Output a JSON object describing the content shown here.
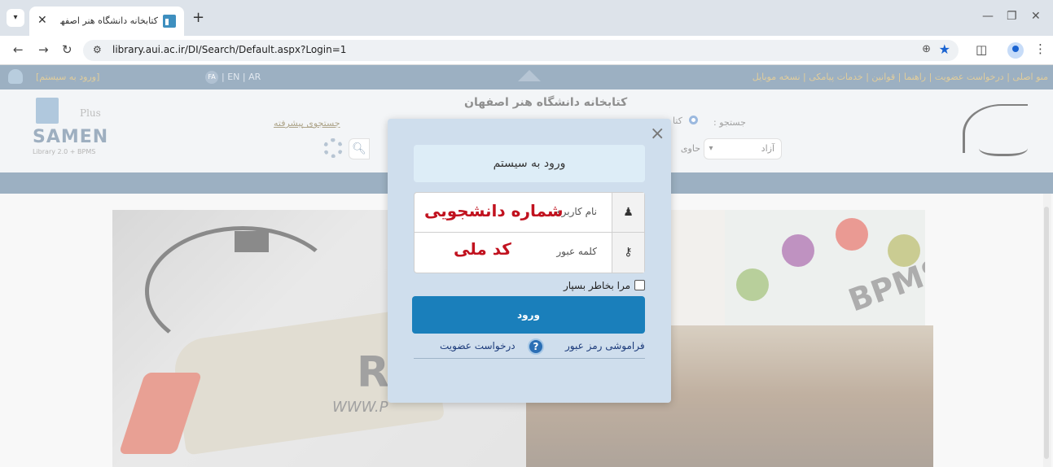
{
  "browser": {
    "tab_title": "کتابخانه دانشگاه هنر اصفهان ، کتا",
    "new_tab_label": "+",
    "url": "library.aui.ac.ir/DI/Search/Default.aspx?Login=1"
  },
  "topnav": {
    "login_link": "[ورود به سیستم]",
    "lang_fa": "FA",
    "lang_others": "| EN | AR",
    "links": "منو اصلی | درخواست عضویت | راهنما | قوانین | خدمات پیامکی | نسخه موبایل"
  },
  "header": {
    "site_title": "کتابخانه دانشگاه هنر اصفهان",
    "advanced_search": "جستجوی پیشرفته",
    "search_label": "جستجو :",
    "radio_text": "کتا",
    "free_option": "آزاد",
    "contains_option": "حاوی",
    "logo_plus": "Plus",
    "logo_word": "SAMEN",
    "logo_sub": "Library 2.0 + BPMS"
  },
  "content": {
    "rfid_text": "R",
    "rfid_www": "WWW.P",
    "bpms_text": "BPMS"
  },
  "modal": {
    "title": "ورود به سیستم",
    "username_placeholder": "نام کاربری",
    "username_value": "شماره دانشجویی",
    "password_placeholder": "کلمه عبور",
    "password_value": "کد ملی",
    "remember_label": "مرا بخاطر بسپار",
    "login_button": "ورود",
    "forgot_password": "فراموشی رمز عبور",
    "help_glyph": "?",
    "register_link": "درخواست عضویت",
    "close_glyph": "×"
  },
  "colors": {
    "topnav_bg": "#4b6f91",
    "accent_gold": "#c9a44a",
    "login_button": "#1a7fbb",
    "annotation_red": "#c1121f",
    "modal_bg": "#cfdeed"
  },
  "icons": [
    "tab-dropdown-icon",
    "close-icon",
    "back-icon",
    "forward-icon",
    "reload-icon",
    "site-info-icon",
    "zoom-icon",
    "star-icon",
    "extensions-icon",
    "profile-icon",
    "menu-icon",
    "user-icon",
    "key-icon",
    "help-icon",
    "search-icon",
    "settings-icon"
  ]
}
